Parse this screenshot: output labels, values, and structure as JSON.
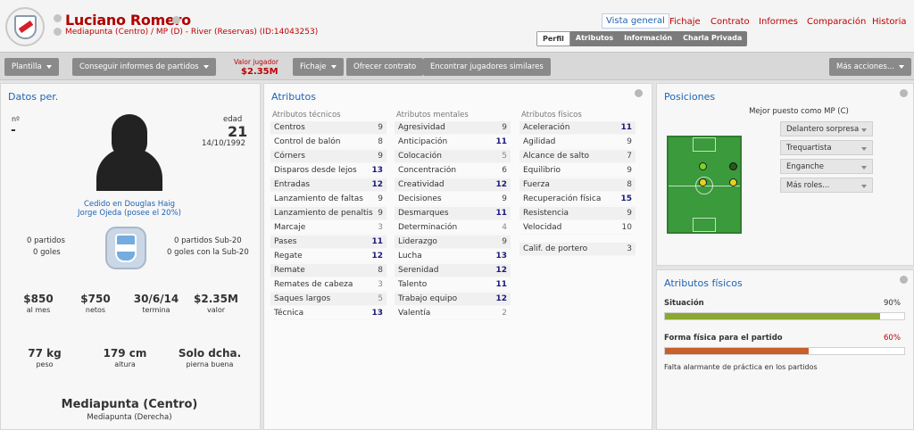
{
  "header": {
    "player_name": "Luciano Romero",
    "player_sub": "Mediapunta (Centro) / MP (D) - River (Reservas) (ID:14043253)",
    "nav": [
      "Vista general",
      "Fichaje",
      "Contrato",
      "Informes",
      "Comparación",
      "Historia"
    ],
    "subtabs": [
      "Perfil",
      "Atributos",
      "Información",
      "Charla Privada"
    ]
  },
  "toolbar": {
    "plantilla": "Plantilla",
    "informes": "Conseguir informes de partidos",
    "valor_label": "Valor jugador",
    "valor_value": "$2.35M",
    "fichaje": "Fichaje",
    "ofrecer": "Ofrecer contrato",
    "similares": "Encontrar jugadores similares",
    "mas": "Más acciones..."
  },
  "datos": {
    "title": "Datos per.",
    "num_label": "nº",
    "num_value": "-",
    "edad_label": "edad",
    "edad_value": "21",
    "dob": "14/10/1992",
    "loan_line1": "Cedido en Douglas Haig",
    "loan_line2": "Jorge Ojeda (posee el 20%)",
    "left_stats": [
      "0 partidos",
      "0 goles"
    ],
    "right_stats": [
      "0 partidos Sub-20",
      "0 goles con la Sub-20"
    ],
    "money": [
      {
        "value": "$850",
        "label": "al mes"
      },
      {
        "value": "$750",
        "label": "netos"
      },
      {
        "value": "30/6/14",
        "label": "termina"
      },
      {
        "value": "$2.35M",
        "label": "valor"
      }
    ],
    "physical": [
      {
        "value": "77 kg",
        "label": "peso"
      },
      {
        "value": "179 cm",
        "label": "altura"
      },
      {
        "value": "Solo dcha.",
        "label": "pierna buena"
      }
    ],
    "position_main": "Mediapunta (Centro)",
    "position_sub": "Mediapunta (Derecha)"
  },
  "atributos": {
    "title": "Atributos",
    "tecnicos_head": "Atributos técnicos",
    "mentales_head": "Atributos mentales",
    "fisicos_head": "Atributos físicos",
    "tecnicos": [
      {
        "name": "Centros",
        "value": "9"
      },
      {
        "name": "Control de balón",
        "value": "8"
      },
      {
        "name": "Córners",
        "value": "9"
      },
      {
        "name": "Disparos desde lejos",
        "value": "13"
      },
      {
        "name": "Entradas",
        "value": "12"
      },
      {
        "name": "Lanzamiento de faltas",
        "value": "9"
      },
      {
        "name": "Lanzamiento de penaltis",
        "value": "9"
      },
      {
        "name": "Marcaje",
        "value": "3"
      },
      {
        "name": "Pases",
        "value": "11"
      },
      {
        "name": "Regate",
        "value": "12"
      },
      {
        "name": "Remate",
        "value": "8"
      },
      {
        "name": "Remates de cabeza",
        "value": "3"
      },
      {
        "name": "Saques largos",
        "value": "5"
      },
      {
        "name": "Técnica",
        "value": "13"
      }
    ],
    "mentales": [
      {
        "name": "Agresividad",
        "value": "9"
      },
      {
        "name": "Anticipación",
        "value": "11"
      },
      {
        "name": "Colocación",
        "value": "5"
      },
      {
        "name": "Concentración",
        "value": "6"
      },
      {
        "name": "Creatividad",
        "value": "12"
      },
      {
        "name": "Decisiones",
        "value": "9"
      },
      {
        "name": "Desmarques",
        "value": "11"
      },
      {
        "name": "Determinación",
        "value": "4"
      },
      {
        "name": "Liderazgo",
        "value": "9"
      },
      {
        "name": "Lucha",
        "value": "13"
      },
      {
        "name": "Serenidad",
        "value": "12"
      },
      {
        "name": "Talento",
        "value": "11"
      },
      {
        "name": "Trabajo equipo",
        "value": "12"
      },
      {
        "name": "Valentía",
        "value": "2"
      }
    ],
    "fisicos": [
      {
        "name": "Aceleración",
        "value": "11"
      },
      {
        "name": "Agilidad",
        "value": "9"
      },
      {
        "name": "Alcance de salto",
        "value": "7"
      },
      {
        "name": "Equilibrio",
        "value": "9"
      },
      {
        "name": "Fuerza",
        "value": "8"
      },
      {
        "name": "Recuperación física",
        "value": "15"
      },
      {
        "name": "Resistencia",
        "value": "9"
      },
      {
        "name": "Velocidad",
        "value": "10"
      }
    ],
    "portero": {
      "name": "Calif. de portero",
      "value": "3"
    }
  },
  "posiciones": {
    "title": "Posiciones",
    "mejor": "Mejor puesto como MP (C)",
    "roles": [
      "Delantero sorpresa",
      "Trequartista",
      "Enganche",
      "Más roles..."
    ]
  },
  "fisicos_panel": {
    "title": "Atributos físicos",
    "situacion_label": "Situación",
    "situacion_value": "90%",
    "situacion_fraction": 0.9,
    "forma_label": "Forma física para el partido",
    "forma_value": "60%",
    "forma_fraction": 0.6,
    "note": "Falta alarmante de práctica en los partidos",
    "colors": {
      "good": "#8aa832",
      "warn": "#c8602a",
      "warn_text": "#c00000"
    }
  }
}
